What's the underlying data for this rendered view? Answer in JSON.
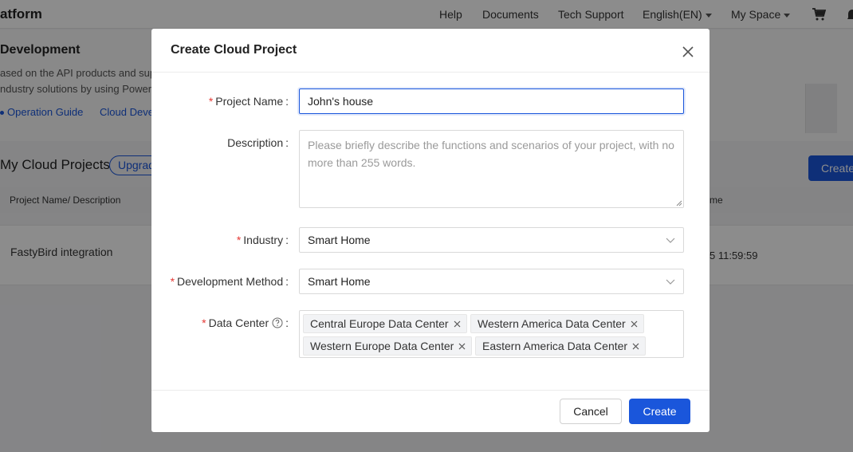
{
  "topbar": {
    "brand": "atform",
    "help": "Help",
    "documents": "Documents",
    "tech_support": "Tech Support",
    "language": "English(EN)",
    "my_space": "My Space",
    "cart_icon": "cart-icon",
    "bell_icon": "bell-icon"
  },
  "background": {
    "dev_title": "Development",
    "dev_desc_line1": "ased on the API products and sup",
    "dev_desc_line2": "ndustry solutions by using Powere",
    "operation_guide": "Operation Guide",
    "cloud_dev": "Cloud Deve",
    "projects_title": "My Cloud Projects",
    "upgrade": "Upgrad",
    "create_button": "Create",
    "table": {
      "col_name": "Project Name/ Description",
      "col_time": "me",
      "rows": [
        {
          "name": "FastyBird integration",
          "time": "5 11:59:59"
        }
      ]
    }
  },
  "modal": {
    "title": "Create Cloud Project",
    "project_name_label": "Project Name",
    "project_name_value": "John's house",
    "description_label": "Description",
    "description_placeholder": "Please briefly describe the functions and scenarios of your project, with no more than 255 words.",
    "industry_label": "Industry",
    "industry_value": "Smart Home",
    "dev_method_label": "Development Method",
    "dev_method_value": "Smart Home",
    "data_center_label": "Data Center",
    "data_centers": [
      "Central Europe Data Center",
      "Western America Data Center",
      "Western Europe Data Center",
      "Eastern America Data Center"
    ],
    "cancel": "Cancel",
    "create": "Create"
  },
  "colors": {
    "accent": "#1a56db",
    "required": "#e53935"
  }
}
